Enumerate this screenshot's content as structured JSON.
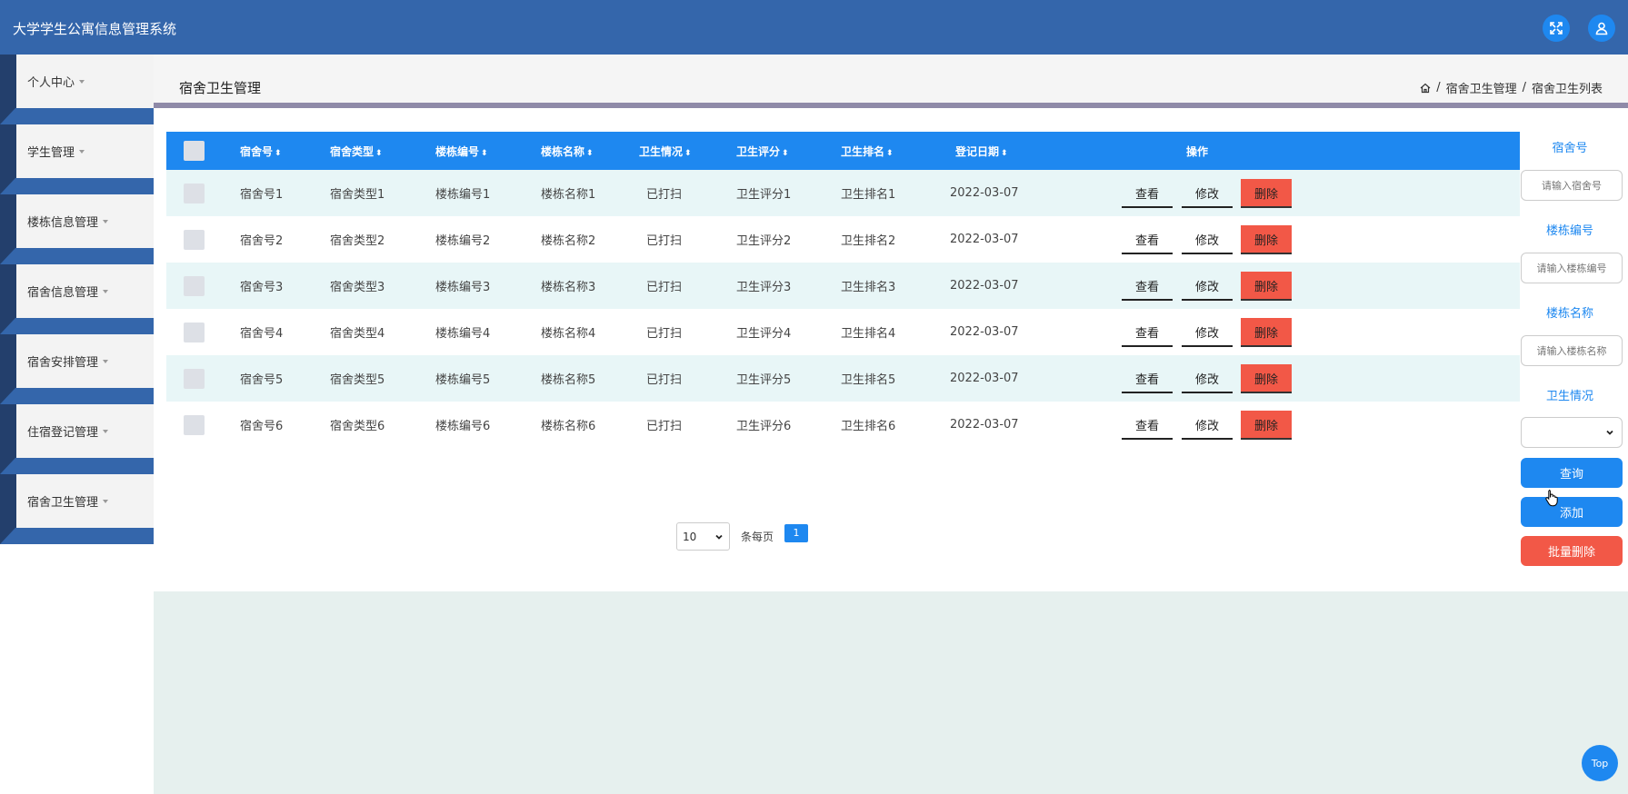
{
  "app": {
    "title": "大学学生公寓信息管理系统"
  },
  "sidebar": {
    "items": [
      {
        "label": "个人中心"
      },
      {
        "label": "学生管理"
      },
      {
        "label": "楼栋信息管理"
      },
      {
        "label": "宿舍信息管理"
      },
      {
        "label": "宿舍安排管理"
      },
      {
        "label": "住宿登记管理"
      },
      {
        "label": "宿舍卫生管理"
      }
    ]
  },
  "page": {
    "title": "宿舍卫生管理",
    "breadcrumb": [
      "宿舍卫生管理",
      "宿舍卫生列表"
    ],
    "separator": "/"
  },
  "table": {
    "columns": [
      "宿舍号",
      "宿舍类型",
      "楼栋编号",
      "楼栋名称",
      "卫生情况",
      "卫生评分",
      "卫生排名",
      "登记日期",
      "操作"
    ],
    "sort_glyph": "⬍",
    "rows": [
      {
        "no": "宿舍号1",
        "type": "宿舍类型1",
        "bno": "楼栋编号1",
        "bname": "楼栋名称1",
        "status": "已打扫",
        "score": "卫生评分1",
        "rank": "卫生排名1",
        "date": "2022-03-07"
      },
      {
        "no": "宿舍号2",
        "type": "宿舍类型2",
        "bno": "楼栋编号2",
        "bname": "楼栋名称2",
        "status": "已打扫",
        "score": "卫生评分2",
        "rank": "卫生排名2",
        "date": "2022-03-07"
      },
      {
        "no": "宿舍号3",
        "type": "宿舍类型3",
        "bno": "楼栋编号3",
        "bname": "楼栋名称3",
        "status": "已打扫",
        "score": "卫生评分3",
        "rank": "卫生排名3",
        "date": "2022-03-07"
      },
      {
        "no": "宿舍号4",
        "type": "宿舍类型4",
        "bno": "楼栋编号4",
        "bname": "楼栋名称4",
        "status": "已打扫",
        "score": "卫生评分4",
        "rank": "卫生排名4",
        "date": "2022-03-07"
      },
      {
        "no": "宿舍号5",
        "type": "宿舍类型5",
        "bno": "楼栋编号5",
        "bname": "楼栋名称5",
        "status": "已打扫",
        "score": "卫生评分5",
        "rank": "卫生排名5",
        "date": "2022-03-07"
      },
      {
        "no": "宿舍号6",
        "type": "宿舍类型6",
        "bno": "楼栋编号6",
        "bname": "楼栋名称6",
        "status": "已打扫",
        "score": "卫生评分6",
        "rank": "卫生排名6",
        "date": "2022-03-07"
      }
    ],
    "actions": {
      "view": "查看",
      "edit": "修改",
      "delete": "删除"
    }
  },
  "pager": {
    "page_size": "10",
    "per_page_label": "条每页",
    "current_page": "1"
  },
  "search": {
    "no_label": "宿舍号",
    "no_placeholder": "请输入宿舍号",
    "bno_label": "楼栋编号",
    "bno_placeholder": "请输入楼栋编号",
    "bname_label": "楼栋名称",
    "bname_placeholder": "请输入楼栋名称",
    "status_label": "卫生情况",
    "query": "查询",
    "add": "添加",
    "batch_delete": "批量删除"
  },
  "top_button": "Top",
  "colors": {
    "header": "#3466ab",
    "primary": "#1e88f0",
    "danger": "#f25847",
    "sidebar_dark": "#233f6c"
  }
}
